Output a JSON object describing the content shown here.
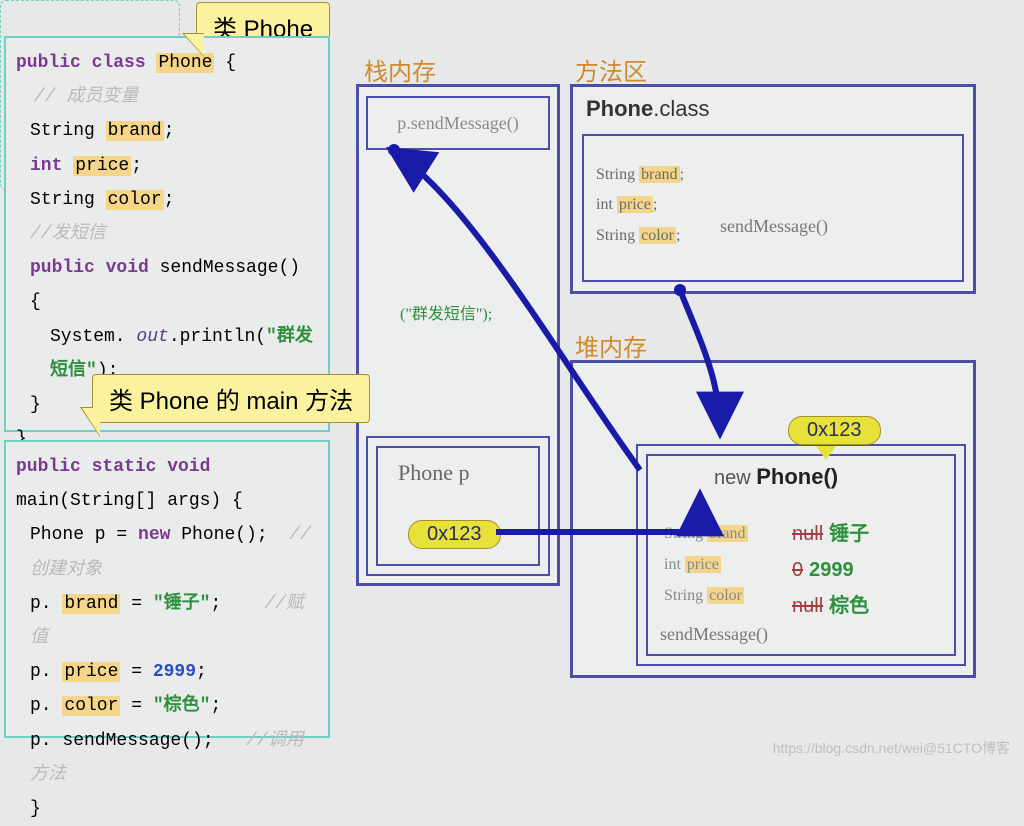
{
  "callouts": {
    "class_label": "类 Phohe",
    "main_label": "类 Phone 的 main 方法"
  },
  "regions": {
    "stack": "栈内存",
    "method_area": "方法区",
    "heap": "堆内存"
  },
  "code_class": {
    "decl": "public class Phone {",
    "member_comment": "// 成员变量",
    "f_brand": "String brand;",
    "f_price": "int price;",
    "f_color": "String color;",
    "sms_comment": "//发短信",
    "method_sig": "public void sendMessage() {",
    "println_pre": "System. out. println(",
    "println_str": "\"群发短信\"",
    "println_post": ");",
    "close1": "}",
    "close2": "}"
  },
  "code_main": {
    "sig": "public static void main(String[] args) {",
    "l1a": "Phone p = new Phone();",
    "l1c": "//创建对象",
    "l2a": "p. brand = ",
    "l2s": "\"锤子\"",
    "l2b": ";",
    "l2c": "//赋值",
    "l3a": "p. price = ",
    "l3n": "2999",
    "l3b": ";",
    "l4a": "p. color = ",
    "l4s": "\"棕色\"",
    "l4b": ";",
    "l5a": "p. sendMessage();",
    "l5c": "//调用方法",
    "close": "}"
  },
  "stack": {
    "frame_call": "p.sendMessage()",
    "dash_text": "(\"群发短信\");",
    "phone_p": "Phone  p",
    "addr": "0x123"
  },
  "method_area": {
    "title_cls": "Phone",
    "title_suf": ".class",
    "f1": "String brand;",
    "f2": "int price;",
    "f3": "String color;",
    "send": "sendMessage()"
  },
  "heap": {
    "new_pre": "new ",
    "new_obj": "Phone()",
    "addr": "0x123",
    "f1": "String brand",
    "f2": "int price",
    "f3": "String color",
    "v1_old": "null",
    "v1_new": "锤子",
    "v2_old": "0",
    "v2_new": "2999",
    "v3_old": "null",
    "v3_new": "棕色",
    "send": "sendMessage()"
  },
  "watermark": "https://blog.csdn.net/wei@51CTO博客"
}
